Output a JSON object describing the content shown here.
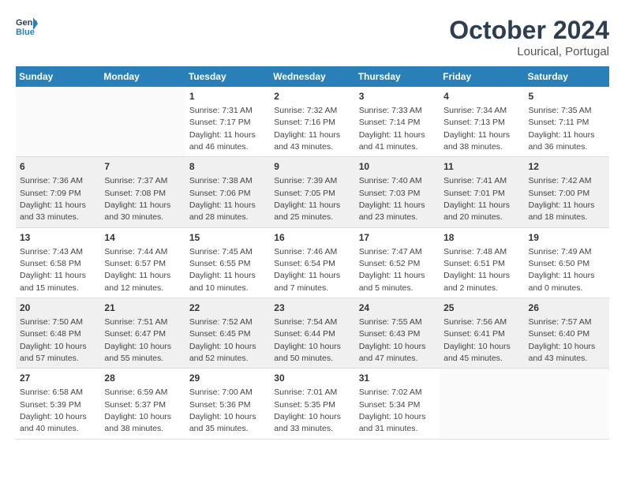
{
  "header": {
    "logo_line1": "General",
    "logo_line2": "Blue",
    "month_title": "October 2024",
    "location": "Lourical, Portugal"
  },
  "weekdays": [
    "Sunday",
    "Monday",
    "Tuesday",
    "Wednesday",
    "Thursday",
    "Friday",
    "Saturday"
  ],
  "weeks": [
    [
      {
        "day": "",
        "sunrise": "",
        "sunset": "",
        "daylight": ""
      },
      {
        "day": "",
        "sunrise": "",
        "sunset": "",
        "daylight": ""
      },
      {
        "day": "1",
        "sunrise": "Sunrise: 7:31 AM",
        "sunset": "Sunset: 7:17 PM",
        "daylight": "Daylight: 11 hours and 46 minutes."
      },
      {
        "day": "2",
        "sunrise": "Sunrise: 7:32 AM",
        "sunset": "Sunset: 7:16 PM",
        "daylight": "Daylight: 11 hours and 43 minutes."
      },
      {
        "day": "3",
        "sunrise": "Sunrise: 7:33 AM",
        "sunset": "Sunset: 7:14 PM",
        "daylight": "Daylight: 11 hours and 41 minutes."
      },
      {
        "day": "4",
        "sunrise": "Sunrise: 7:34 AM",
        "sunset": "Sunset: 7:13 PM",
        "daylight": "Daylight: 11 hours and 38 minutes."
      },
      {
        "day": "5",
        "sunrise": "Sunrise: 7:35 AM",
        "sunset": "Sunset: 7:11 PM",
        "daylight": "Daylight: 11 hours and 36 minutes."
      }
    ],
    [
      {
        "day": "6",
        "sunrise": "Sunrise: 7:36 AM",
        "sunset": "Sunset: 7:09 PM",
        "daylight": "Daylight: 11 hours and 33 minutes."
      },
      {
        "day": "7",
        "sunrise": "Sunrise: 7:37 AM",
        "sunset": "Sunset: 7:08 PM",
        "daylight": "Daylight: 11 hours and 30 minutes."
      },
      {
        "day": "8",
        "sunrise": "Sunrise: 7:38 AM",
        "sunset": "Sunset: 7:06 PM",
        "daylight": "Daylight: 11 hours and 28 minutes."
      },
      {
        "day": "9",
        "sunrise": "Sunrise: 7:39 AM",
        "sunset": "Sunset: 7:05 PM",
        "daylight": "Daylight: 11 hours and 25 minutes."
      },
      {
        "day": "10",
        "sunrise": "Sunrise: 7:40 AM",
        "sunset": "Sunset: 7:03 PM",
        "daylight": "Daylight: 11 hours and 23 minutes."
      },
      {
        "day": "11",
        "sunrise": "Sunrise: 7:41 AM",
        "sunset": "Sunset: 7:01 PM",
        "daylight": "Daylight: 11 hours and 20 minutes."
      },
      {
        "day": "12",
        "sunrise": "Sunrise: 7:42 AM",
        "sunset": "Sunset: 7:00 PM",
        "daylight": "Daylight: 11 hours and 18 minutes."
      }
    ],
    [
      {
        "day": "13",
        "sunrise": "Sunrise: 7:43 AM",
        "sunset": "Sunset: 6:58 PM",
        "daylight": "Daylight: 11 hours and 15 minutes."
      },
      {
        "day": "14",
        "sunrise": "Sunrise: 7:44 AM",
        "sunset": "Sunset: 6:57 PM",
        "daylight": "Daylight: 11 hours and 12 minutes."
      },
      {
        "day": "15",
        "sunrise": "Sunrise: 7:45 AM",
        "sunset": "Sunset: 6:55 PM",
        "daylight": "Daylight: 11 hours and 10 minutes."
      },
      {
        "day": "16",
        "sunrise": "Sunrise: 7:46 AM",
        "sunset": "Sunset: 6:54 PM",
        "daylight": "Daylight: 11 hours and 7 minutes."
      },
      {
        "day": "17",
        "sunrise": "Sunrise: 7:47 AM",
        "sunset": "Sunset: 6:52 PM",
        "daylight": "Daylight: 11 hours and 5 minutes."
      },
      {
        "day": "18",
        "sunrise": "Sunrise: 7:48 AM",
        "sunset": "Sunset: 6:51 PM",
        "daylight": "Daylight: 11 hours and 2 minutes."
      },
      {
        "day": "19",
        "sunrise": "Sunrise: 7:49 AM",
        "sunset": "Sunset: 6:50 PM",
        "daylight": "Daylight: 11 hours and 0 minutes."
      }
    ],
    [
      {
        "day": "20",
        "sunrise": "Sunrise: 7:50 AM",
        "sunset": "Sunset: 6:48 PM",
        "daylight": "Daylight: 10 hours and 57 minutes."
      },
      {
        "day": "21",
        "sunrise": "Sunrise: 7:51 AM",
        "sunset": "Sunset: 6:47 PM",
        "daylight": "Daylight: 10 hours and 55 minutes."
      },
      {
        "day": "22",
        "sunrise": "Sunrise: 7:52 AM",
        "sunset": "Sunset: 6:45 PM",
        "daylight": "Daylight: 10 hours and 52 minutes."
      },
      {
        "day": "23",
        "sunrise": "Sunrise: 7:54 AM",
        "sunset": "Sunset: 6:44 PM",
        "daylight": "Daylight: 10 hours and 50 minutes."
      },
      {
        "day": "24",
        "sunrise": "Sunrise: 7:55 AM",
        "sunset": "Sunset: 6:43 PM",
        "daylight": "Daylight: 10 hours and 47 minutes."
      },
      {
        "day": "25",
        "sunrise": "Sunrise: 7:56 AM",
        "sunset": "Sunset: 6:41 PM",
        "daylight": "Daylight: 10 hours and 45 minutes."
      },
      {
        "day": "26",
        "sunrise": "Sunrise: 7:57 AM",
        "sunset": "Sunset: 6:40 PM",
        "daylight": "Daylight: 10 hours and 43 minutes."
      }
    ],
    [
      {
        "day": "27",
        "sunrise": "Sunrise: 6:58 AM",
        "sunset": "Sunset: 5:39 PM",
        "daylight": "Daylight: 10 hours and 40 minutes."
      },
      {
        "day": "28",
        "sunrise": "Sunrise: 6:59 AM",
        "sunset": "Sunset: 5:37 PM",
        "daylight": "Daylight: 10 hours and 38 minutes."
      },
      {
        "day": "29",
        "sunrise": "Sunrise: 7:00 AM",
        "sunset": "Sunset: 5:36 PM",
        "daylight": "Daylight: 10 hours and 35 minutes."
      },
      {
        "day": "30",
        "sunrise": "Sunrise: 7:01 AM",
        "sunset": "Sunset: 5:35 PM",
        "daylight": "Daylight: 10 hours and 33 minutes."
      },
      {
        "day": "31",
        "sunrise": "Sunrise: 7:02 AM",
        "sunset": "Sunset: 5:34 PM",
        "daylight": "Daylight: 10 hours and 31 minutes."
      },
      {
        "day": "",
        "sunrise": "",
        "sunset": "",
        "daylight": ""
      },
      {
        "day": "",
        "sunrise": "",
        "sunset": "",
        "daylight": ""
      }
    ]
  ]
}
